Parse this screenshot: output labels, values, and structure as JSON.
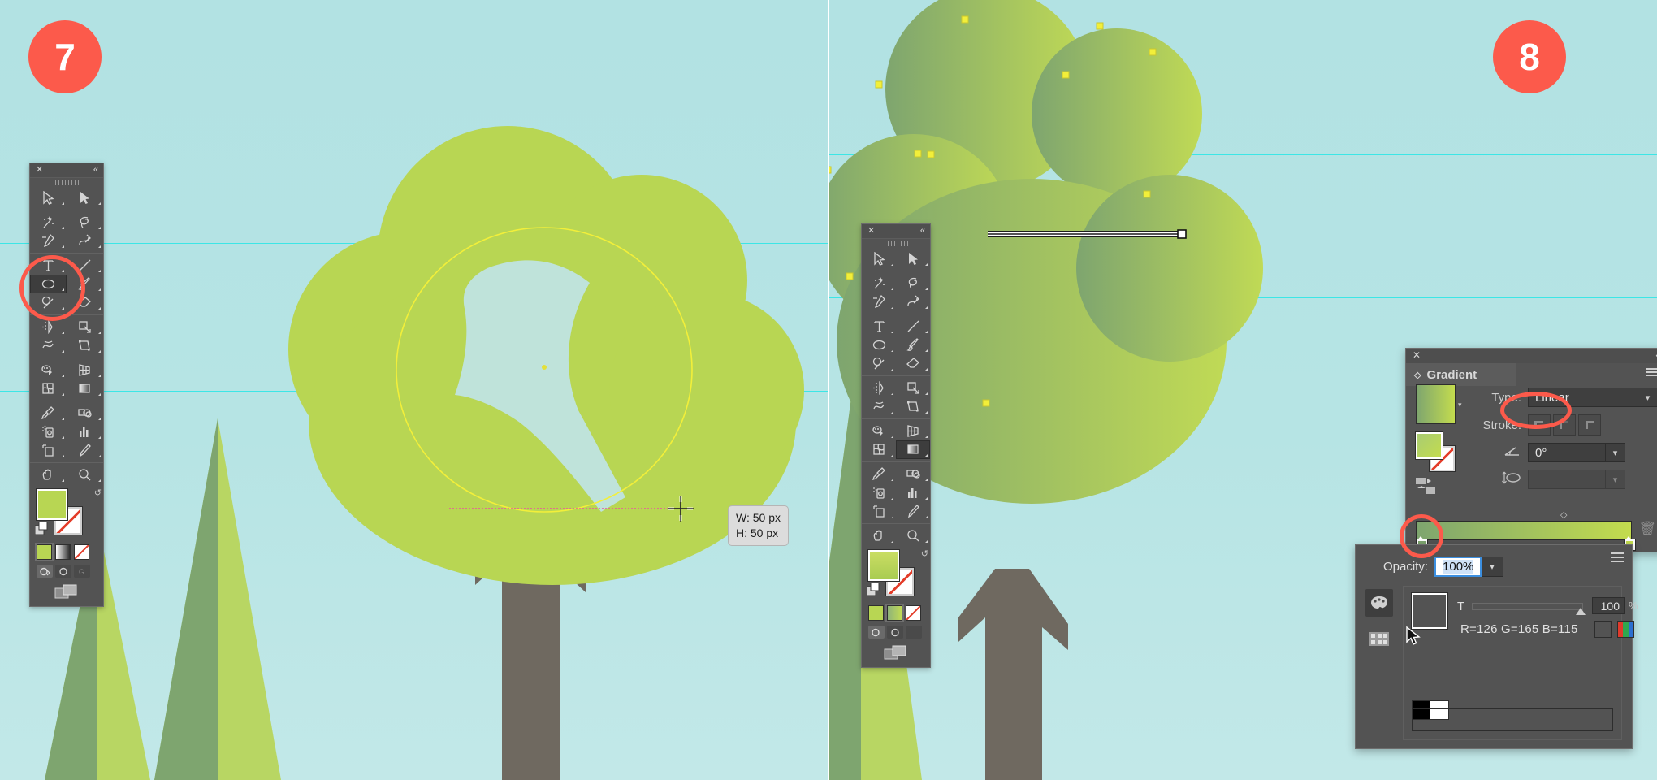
{
  "app": "Adobe Illustrator tutorial screenshot",
  "panels": [
    {
      "id": "panel-7",
      "badge": "7",
      "toolbar": {
        "close_icon": "close-icon",
        "collapse_icon": "double-chevron-left-icon",
        "selected_tool": "ellipse-tool",
        "tools": [
          "selection-tool",
          "direct-selection-tool",
          "magic-wand-tool",
          "lasso-tool",
          "pen-tool",
          "curvature-tool",
          "type-tool",
          "line-segment-tool",
          "ellipse-tool",
          "paintbrush-tool",
          "shaper-tool",
          "eraser-tool",
          "rotate-tool",
          "scale-tool",
          "width-tool",
          "free-transform-tool",
          "shape-builder-tool",
          "perspective-grid-tool",
          "mesh-tool",
          "gradient-tool",
          "eyedropper-tool",
          "blend-tool",
          "symbol-sprayer-tool",
          "column-graph-tool",
          "artboard-tool",
          "slice-tool",
          "hand-tool",
          "zoom-tool"
        ],
        "fill_color": "#b8d653",
        "stroke_color": "#ffffff",
        "mode_swatches": [
          "color",
          "gradient",
          "none"
        ],
        "draw_modes": [
          "draw-normal",
          "draw-behind",
          "draw-inside"
        ]
      },
      "canvas": {
        "sky_color": "#b2e2e3",
        "guide_color": "#27e6e6",
        "foliage_color": "#b8d653",
        "trunk_color": "#6f6960",
        "pine_dark": "#7ea56f",
        "pine_light": "#b8d663",
        "drawing_ellipse_stroke": "#f2ef3a",
        "smart_guide_color": "#e8559d"
      },
      "tooltip": {
        "width": "W: 50 px",
        "height": "H: 50 px"
      }
    },
    {
      "id": "panel-8",
      "badge": "8",
      "toolbar": {
        "close_icon": "close-icon",
        "collapse_icon": "double-chevron-left-icon",
        "selected_tool": "gradient-tool",
        "fill_color": "#b8d653",
        "stroke_color": "#ffffff"
      },
      "canvas": {
        "sky_color": "#b2e2e3",
        "anchor_color": "#f2ef3a",
        "gradient_annotator": "linear-gradient-annotator",
        "foliage_gradient_from": "#7ea56f",
        "foliage_gradient_to": "#b8d653"
      }
    }
  ],
  "gradient_panel": {
    "title": "Gradient",
    "close_icon": "close-icon",
    "collapse_icon": "double-chevron-left-icon",
    "menu_icon": "panel-menu-icon",
    "type_label": "Type:",
    "type_value": "Linear",
    "type_highlighted": true,
    "stroke_label": "Stroke:",
    "stroke_options": [
      "stroke-within",
      "stroke-centered",
      "stroke-outside"
    ],
    "angle_label": "angle-icon",
    "angle_value": "0°",
    "aspect_label": "aspect-ratio-icon",
    "aspect_value": "",
    "slider_from": "#7ea56f",
    "slider_to": "#c3dc4e",
    "midpoint_marker": "gradient-midpoint-diamond",
    "stop_left_color": "#7ea56f",
    "stop_right_color": "#c3dc4e",
    "stop_left_highlighted": true,
    "delete_stop_icon": "trash-icon",
    "preview_from": "#7ea56f",
    "preview_to": "#c3dc4e",
    "reverse_icon": "reverse-gradient-icon"
  },
  "color_panel": {
    "menu_icon": "panel-menu-icon",
    "opacity_label": "Opacity:",
    "opacity_value": "100%",
    "swatch_color": "#7ea573",
    "tint_label": "T",
    "tint_value": "100",
    "tint_unit": "%",
    "rgb_readout": "R=126 G=165 B=115",
    "none_swatch": "none-swatch",
    "spectrum_swatch": "rgb-spectrum-swatch",
    "black_white_swatch": "black-white-swatch",
    "ramp_from": "#ffffff",
    "ramp_to": "#7ea573",
    "side_tabs": [
      "color-palette-tab",
      "swatches-tab"
    ],
    "cursor": "arrow-cursor"
  }
}
